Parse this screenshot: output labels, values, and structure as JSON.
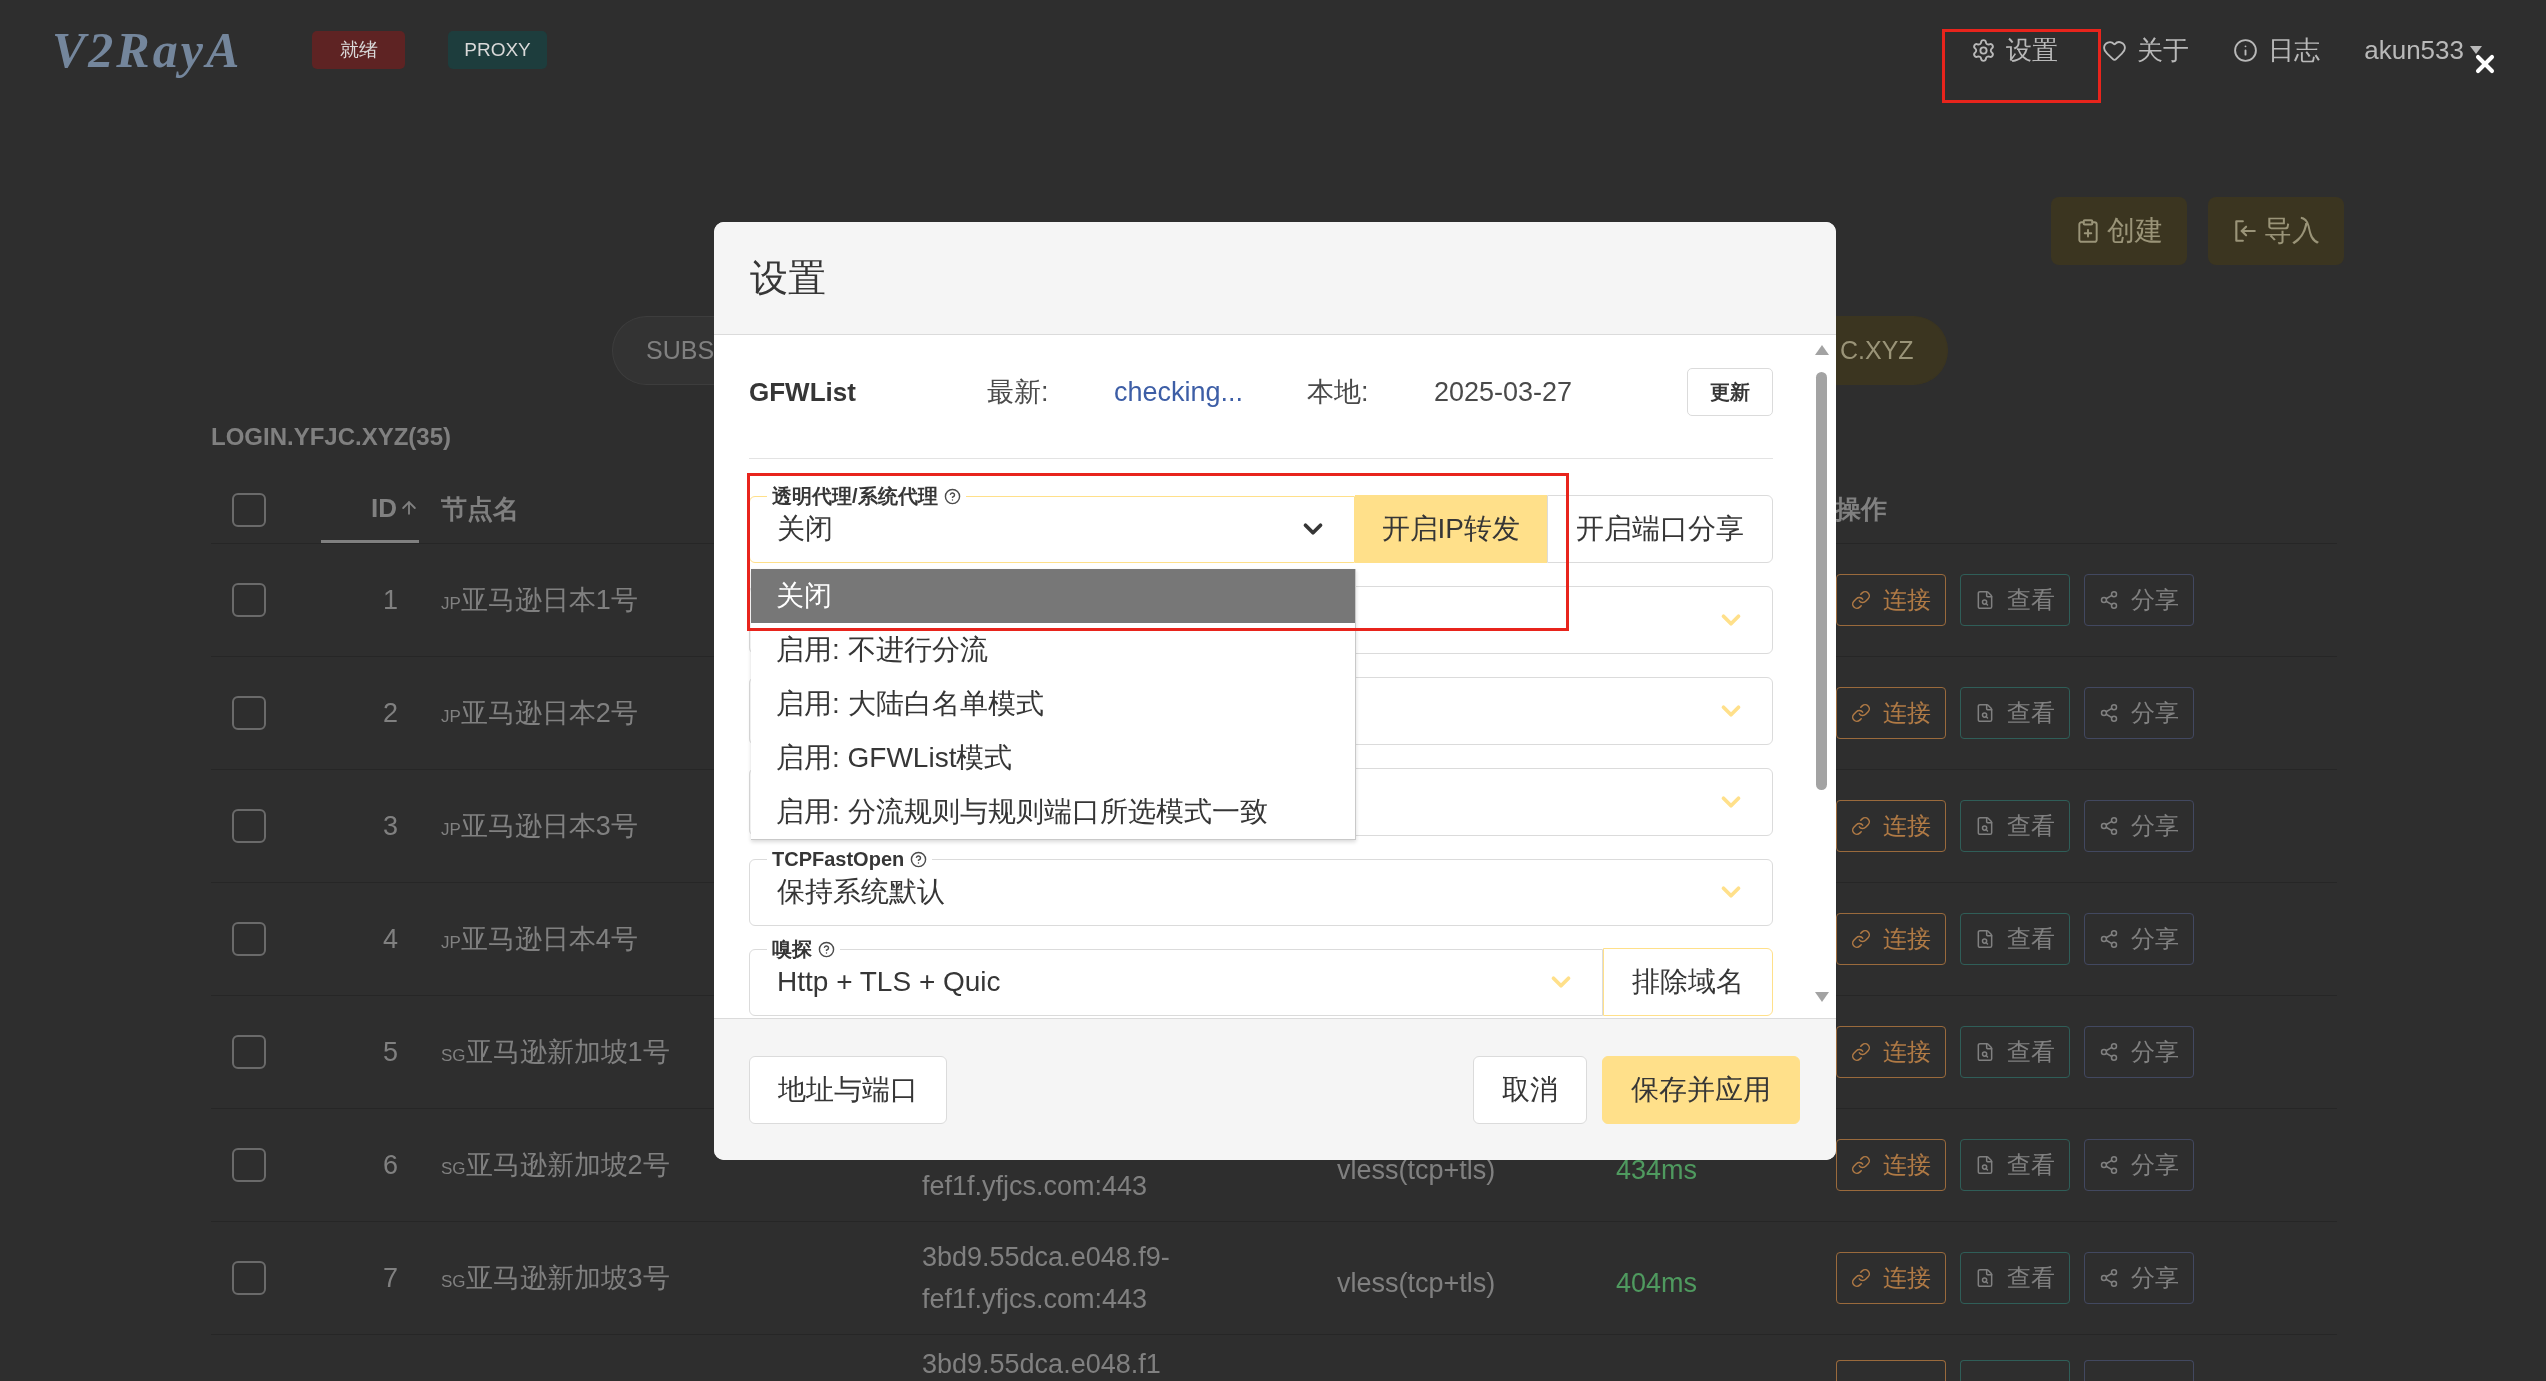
{
  "header": {
    "logo": "V2RayA",
    "badges": [
      {
        "label": "就绪",
        "color": "#5e2323"
      },
      {
        "label": "PROXY",
        "color": "#1d3d3d"
      }
    ],
    "nav": [
      {
        "kind": "gear",
        "label": "设置",
        "highlighted": true
      },
      {
        "kind": "heart",
        "label": "关于",
        "highlighted": false
      },
      {
        "kind": "info",
        "label": "日志",
        "highlighted": false
      }
    ],
    "user": "akun533"
  },
  "toolbar": [
    {
      "kind": "create",
      "label": "创建"
    },
    {
      "kind": "import",
      "label": "导入"
    }
  ],
  "subscription_tabs": [
    {
      "label": "SUBS",
      "selected": false
    },
    {
      "label": "C.XYZ",
      "selected": true
    }
  ],
  "server_table": {
    "title": "LOGIN.YFJC.XYZ(35)",
    "select_all": {
      "checked": false
    },
    "columns": [
      {
        "kind": "id",
        "label": "ID",
        "sorted": true
      },
      {
        "kind": "name",
        "label": "节点名",
        "sorted": false
      },
      {
        "kind": "actions",
        "label": "操作",
        "sorted": false
      }
    ],
    "rows": [
      {
        "checked": false,
        "id": "1",
        "region": "JP",
        "name": "亚马逊日本1号",
        "actions": [
          {
            "kind": "connect",
            "label": "连接"
          },
          {
            "kind": "view",
            "label": "查看"
          },
          {
            "kind": "share",
            "label": "分享"
          }
        ]
      },
      {
        "checked": false,
        "id": "2",
        "region": "JP",
        "name": "亚马逊日本2号",
        "actions": [
          {
            "kind": "connect",
            "label": "连接"
          },
          {
            "kind": "view",
            "label": "查看"
          },
          {
            "kind": "share",
            "label": "分享"
          }
        ]
      },
      {
        "checked": false,
        "id": "3",
        "region": "JP",
        "name": "亚马逊日本3号",
        "actions": [
          {
            "kind": "connect",
            "label": "连接"
          },
          {
            "kind": "view",
            "label": "查看"
          },
          {
            "kind": "share",
            "label": "分享"
          }
        ]
      },
      {
        "checked": false,
        "id": "4",
        "region": "JP",
        "name": "亚马逊日本4号",
        "actions": [
          {
            "kind": "connect",
            "label": "连接"
          },
          {
            "kind": "view",
            "label": "查看"
          },
          {
            "kind": "share",
            "label": "分享"
          }
        ]
      },
      {
        "checked": false,
        "id": "5",
        "region": "SG",
        "name": "亚马逊新加坡1号",
        "actions": [
          {
            "kind": "connect",
            "label": "连接"
          },
          {
            "kind": "view",
            "label": "查看"
          },
          {
            "kind": "share",
            "label": "分享"
          }
        ]
      },
      {
        "checked": false,
        "id": "6",
        "region": "SG",
        "name": "亚马逊新加坡2号",
        "address": "fef1f.yfjcs.com:443",
        "protocol": "vless(tcp+tls)",
        "latency": "434ms",
        "actions": [
          {
            "kind": "connect",
            "label": "连接"
          },
          {
            "kind": "view",
            "label": "查看"
          },
          {
            "kind": "share",
            "label": "分享"
          }
        ]
      },
      {
        "checked": false,
        "id": "7",
        "region": "SG",
        "name": "亚马逊新加坡3号",
        "address": "3bd9.55dca.e048.f9-fef1f.yfjcs.com:443",
        "protocol": "vless(tcp+tls)",
        "latency": "404ms",
        "actions": [
          {
            "kind": "connect",
            "label": "连接"
          },
          {
            "kind": "view",
            "label": "查看"
          },
          {
            "kind": "share",
            "label": "分享"
          }
        ]
      }
    ],
    "partial_row": {
      "address": "3bd9.55dca.e048.f1",
      "actions": [
        {
          "kind": "connect"
        },
        {
          "kind": "view"
        },
        {
          "kind": "share"
        }
      ]
    }
  },
  "settings_dialog": {
    "title": "设置",
    "gfwlist": {
      "name": "GFWList",
      "latest_label": "最新:",
      "latest": "checking...",
      "local_label": "本地:",
      "local": "2025-03-27",
      "update_button": "更新"
    },
    "fields": [
      {
        "kind": "select_with_buttons",
        "label": "透明代理/系统代理",
        "help": true,
        "value": "关闭",
        "expanded": true,
        "highlighted": true,
        "options": [
          {
            "label": "关闭",
            "selected": true
          },
          {
            "label": "启用: 不进行分流",
            "selected": false
          },
          {
            "label": "启用: 大陆白名单模式",
            "selected": false
          },
          {
            "label": "启用: GFWList模式",
            "selected": false
          },
          {
            "label": "启用: 分流规则与规则端口所选模式一致",
            "selected": false
          }
        ],
        "buttons": [
          {
            "kind": "toggle",
            "label": "开启IP转发",
            "on": true
          },
          {
            "kind": "toggle",
            "label": "开启端口分享",
            "on": false
          }
        ]
      },
      {
        "kind": "select",
        "expanded": false,
        "highlighted": false
      },
      {
        "kind": "select",
        "expanded": false,
        "highlighted": false
      },
      {
        "kind": "select",
        "expanded": false,
        "highlighted": false
      },
      {
        "kind": "select",
        "label": "TCPFastOpen",
        "help": true,
        "value": "保持系统默认",
        "expanded": false,
        "highlighted": false
      },
      {
        "kind": "select_with_buttons",
        "label": "嗅探",
        "help": true,
        "value": "Http + TLS + Quic",
        "expanded": false,
        "highlighted": false,
        "buttons": [
          {
            "kind": "action",
            "label": "排除域名"
          }
        ]
      }
    ],
    "footer": [
      {
        "kind": "secondary",
        "label": "地址与端口"
      },
      {
        "kind": "cancel",
        "label": "取消"
      },
      {
        "kind": "primary",
        "label": "保存并应用"
      }
    ]
  }
}
